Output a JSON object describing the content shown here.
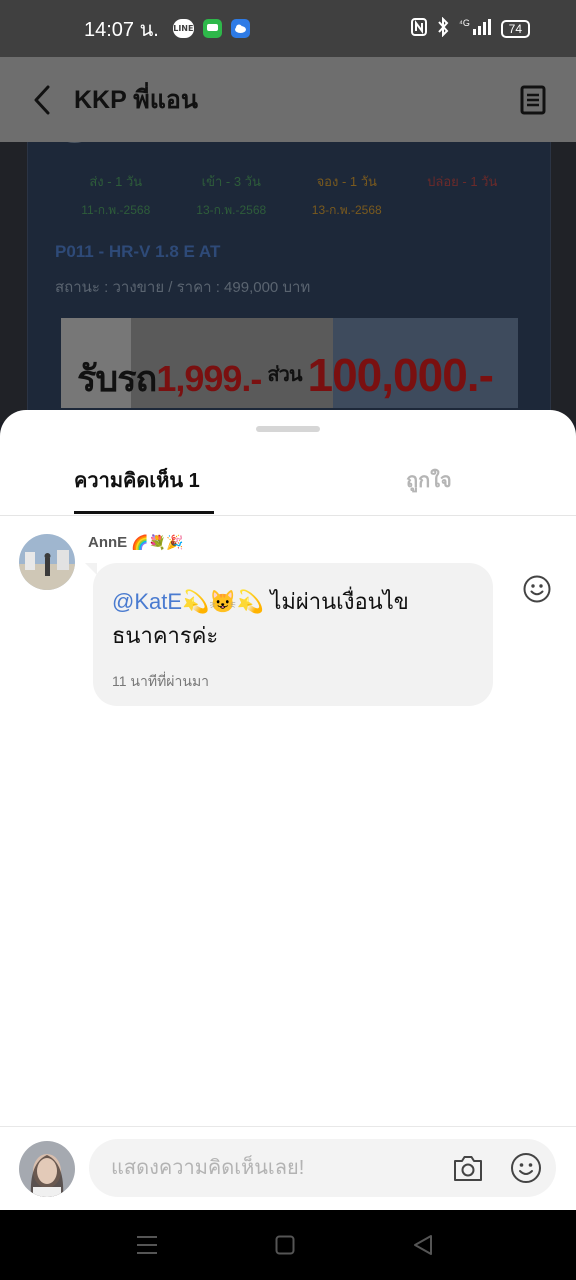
{
  "status_bar": {
    "time": "14:07 น.",
    "battery": "74",
    "icons": [
      "line-icon",
      "messages-icon",
      "weather-icon",
      "nfc-icon",
      "bluetooth-icon",
      "4g-icon",
      "signal-icon",
      "battery-icon"
    ]
  },
  "header": {
    "title": "KKP พี่แอน",
    "back_icon": "chevron-left-icon",
    "menu_icon": "document-icon"
  },
  "background_post": {
    "steps": [
      {
        "label": "ส่ง - 1 วัน",
        "date": "11-ก.พ.-2568"
      },
      {
        "label": "เข้า - 3 วัน",
        "date": "13-ก.พ.-2568"
      },
      {
        "label": "จอง - 1 วัน",
        "date": "13-ก.พ.-2568"
      },
      {
        "label": "ปล่อย - 1 วัน",
        "date": ""
      }
    ],
    "listing_title": "P011 - HR-V 1.8 E AT",
    "listing_sub": "สถานะ : วางขาย / ราคา : 499,000 บาท",
    "banner_text_1": "รับรถ",
    "banner_text_2": "1,999.-",
    "banner_text_3": "ส่วน",
    "banner_text_4": "100,000.-"
  },
  "sheet": {
    "tab_comments": "ความคิดเห็น 1",
    "tab_likes": "ถูกใจ"
  },
  "comment": {
    "author": "AnnE",
    "author_emoji": "🌈💐🎉",
    "mention": "@KatE💫😺💫",
    "text": " ไม่ผ่านเงื่อนไขธนาคารค่ะ",
    "time": "11 นาทีที่ผ่านมา"
  },
  "input": {
    "placeholder": "แสดงความคิดเห็นเลย!",
    "value": ""
  },
  "colors": {
    "mention": "#4a7bd0",
    "header_bg": "#6e6e6e",
    "status_bg": "#404040"
  }
}
